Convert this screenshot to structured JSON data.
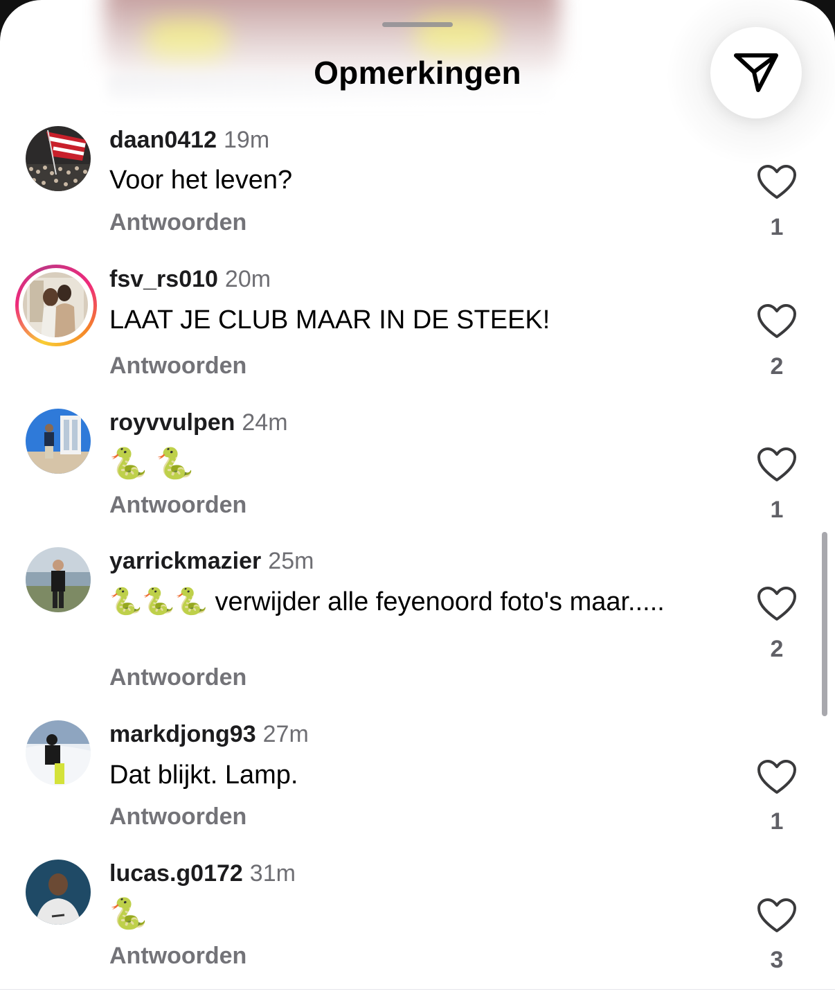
{
  "header": {
    "title": "Opmerkingen",
    "send_icon": "paper-plane-icon"
  },
  "comments": [
    {
      "username": "daan0412",
      "time": "19m",
      "text": "Voor het leven?",
      "reply": "Antwoorden",
      "likes": "1",
      "avatar": "crowd-flag-photo",
      "story_ring": false
    },
    {
      "username": "fsv_rs010",
      "time": "20m",
      "text": "LAAT JE CLUB MAAR IN DE STEEK!",
      "reply": "Antwoorden",
      "likes": "2",
      "avatar": "couple-photo",
      "story_ring": true
    },
    {
      "username": "royvvulpen",
      "time": "24m",
      "text": "🐍 🐍",
      "reply": "Antwoorden",
      "likes": "1",
      "avatar": "person-blue-wall-photo",
      "story_ring": false
    },
    {
      "username": "yarrickmazier",
      "time": "25m",
      "text": "🐍🐍🐍 verwijder alle feyenoord foto's maar.....",
      "reply": "Antwoorden",
      "likes": "2",
      "avatar": "person-beach-photo",
      "story_ring": false
    },
    {
      "username": "markdjong93",
      "time": "27m",
      "text": "Dat blijkt. Lamp.",
      "reply": "Antwoorden",
      "likes": "1",
      "avatar": "skier-photo",
      "story_ring": false
    },
    {
      "username": "lucas.g0172",
      "time": "31m",
      "text": "🐍",
      "reply": "Antwoorden",
      "likes": "3",
      "avatar": "person-back-photo",
      "story_ring": false
    }
  ],
  "colors": {
    "username": "#1c1c1e",
    "timestamp": "#6e6e73",
    "reply": "#737378",
    "like_count": "#606066"
  }
}
